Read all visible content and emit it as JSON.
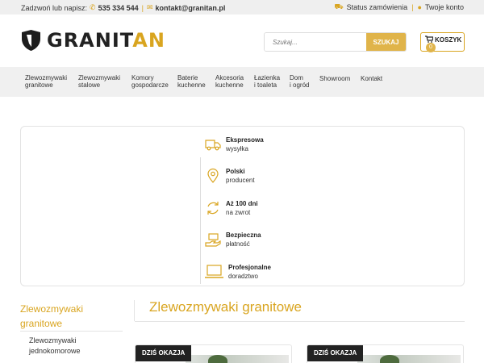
{
  "topbar": {
    "call_label": "Zadzwoń lub napisz:",
    "phone": "535 334 544",
    "email": "kontakt@granitan.pl",
    "order_status": "Status zamówienia",
    "account": "Twoje konto"
  },
  "header": {
    "logo_main": "GRANIT",
    "logo_accent": "AN",
    "search_placeholder": "Szukaj...",
    "search_button": "SZUKAJ",
    "cart_label": "KOSZYK",
    "cart_count": "0"
  },
  "nav": {
    "items": [
      {
        "l1": "Zlewozmywaki",
        "l2": "granitowe"
      },
      {
        "l1": "Zlewozmywaki",
        "l2": "stalowe"
      },
      {
        "l1": "Komory",
        "l2": "gospodarcze"
      },
      {
        "l1": "Baterie",
        "l2": "kuchenne"
      },
      {
        "l1": "Akcesoria",
        "l2": "kuchenne"
      },
      {
        "l1": "Łazienka",
        "l2": "i toaleta"
      },
      {
        "l1": "Dom",
        "l2": "i ogród"
      },
      {
        "l1": "Showroom",
        "l2": ""
      },
      {
        "l1": "Kontakt",
        "l2": ""
      }
    ]
  },
  "features": [
    {
      "title": "Ekspresowa",
      "sub": "wysyłka",
      "icon": "truck-icon"
    },
    {
      "title": "Polski",
      "sub": "producent",
      "icon": "location-pin-icon"
    },
    {
      "title": "Aż 100 dni",
      "sub": "na zwrot",
      "icon": "return-arrows-icon"
    },
    {
      "title": "Bezpieczna",
      "sub": "płatność",
      "icon": "payment-hand-icon"
    },
    {
      "title": "Profesjonalne",
      "sub": "doradztwo",
      "icon": "laptop-icon"
    }
  ],
  "sidebar": {
    "title_l1": "Zlewozmywaki",
    "title_l2": "granitowe",
    "sub_l1": "Zlewozmywaki",
    "sub_l2": "jednokomorowe"
  },
  "main": {
    "title": "Zlewozmywaki granitowe",
    "badge": "DZIŚ OKAZJA"
  },
  "colors": {
    "accent": "#d9a520",
    "button": "#e0b44a",
    "nav_bg": "#f0f0f0"
  }
}
